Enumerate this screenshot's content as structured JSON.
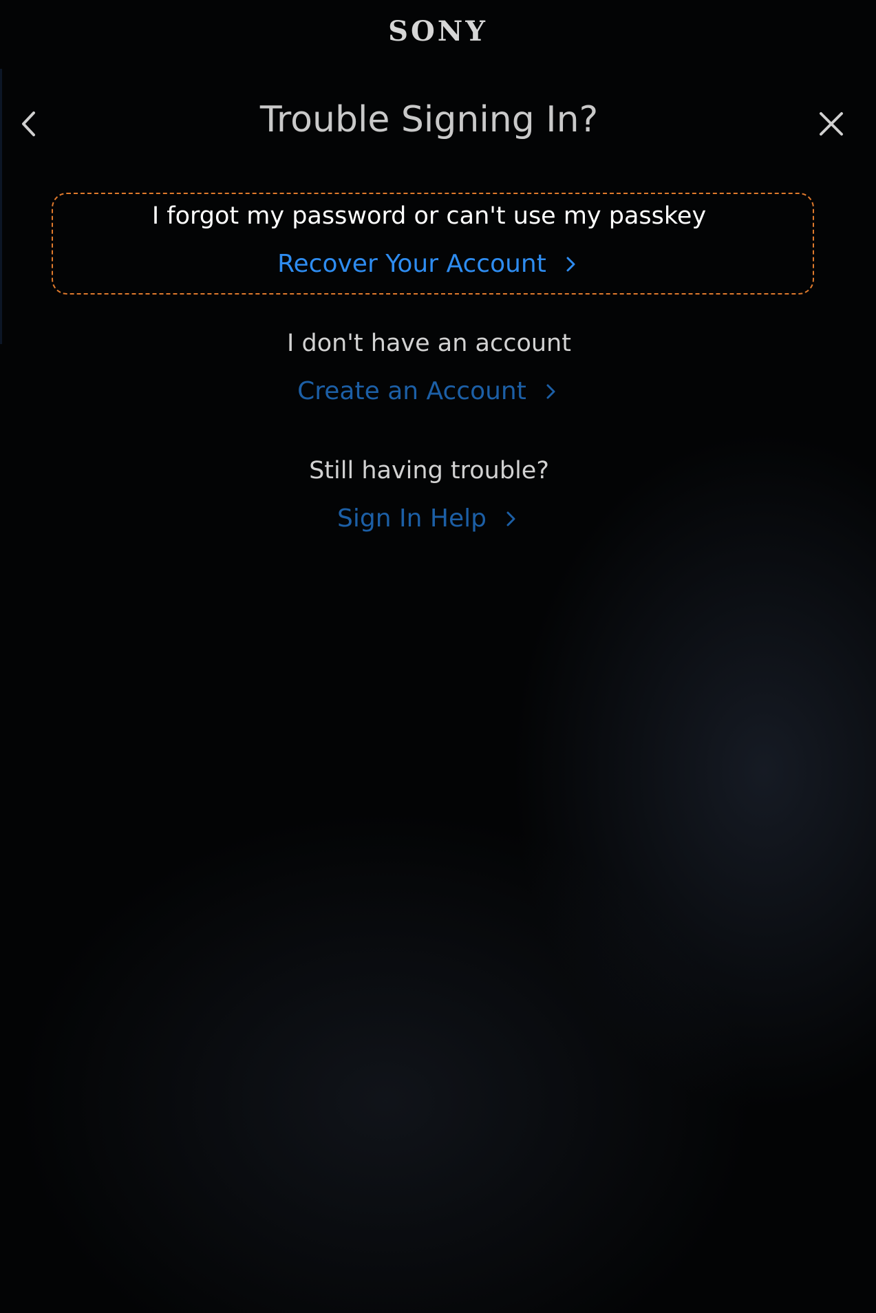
{
  "brand": "SONY",
  "header": {
    "title": "Trouble Signing In?",
    "back_icon": "chevron-left-icon",
    "close_icon": "close-icon"
  },
  "options": [
    {
      "prompt": "I forgot my password or can't use my passkey",
      "link_label": "Recover Your Account",
      "focused": true
    },
    {
      "prompt": "I don't have an account",
      "link_label": "Create an Account",
      "focused": false
    },
    {
      "prompt": "Still having trouble?",
      "link_label": "Sign In Help",
      "focused": false
    }
  ],
  "colors": {
    "background": "#030405",
    "focus_outline": "#e07a2c",
    "link_focused": "#2e8cf0",
    "link": "#1c5fa6",
    "text": "#d2d2d2"
  }
}
